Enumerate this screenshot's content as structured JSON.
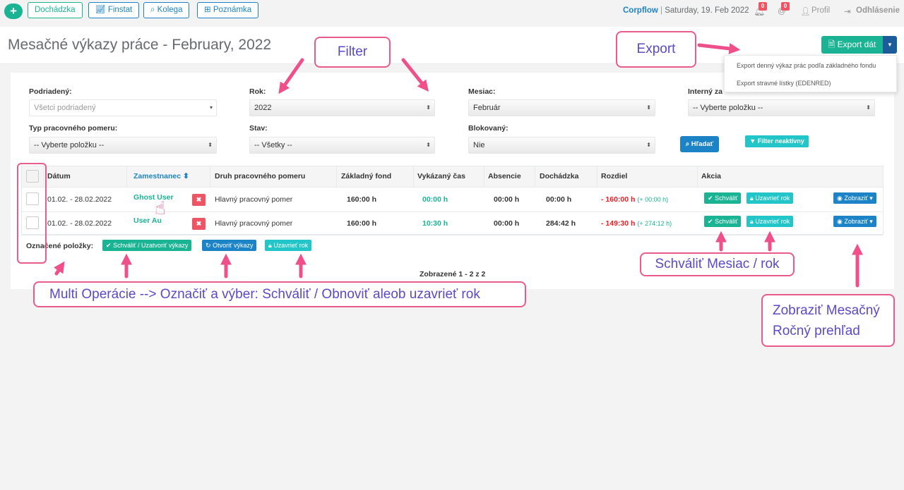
{
  "topbar": {
    "buttons": [
      {
        "label": "Dochádzka",
        "icon": "clock-icon"
      },
      {
        "label": "Finstat",
        "icon": "chart-icon"
      },
      {
        "label": "Kolega",
        "icon": "search-icon"
      },
      {
        "label": "Poznámka",
        "icon": "plus-square-icon"
      }
    ],
    "brand": "Corpflow",
    "date": "Saturday, 19. Feb 2022",
    "bell_count": "0",
    "at_count": "0",
    "profile_label": "Profil",
    "logout_label": "Odhlásenie"
  },
  "page": {
    "title": "Mesačné výkazy práce - February, 2022",
    "export_label": "Export dát",
    "export_menu": [
      "Export denný výkaz prác podľa základného fondu",
      "Export stravné lístky (EDENRED)"
    ]
  },
  "filters": {
    "podriadeny": {
      "label": "Podriadený:",
      "placeholder": "Všetci podriadený"
    },
    "rok": {
      "label": "Rok:",
      "value": "2022"
    },
    "mesiac": {
      "label": "Mesiac:",
      "value": "Február"
    },
    "interny": {
      "label": "Interný za",
      "value": "-- Vyberte položku --"
    },
    "typ": {
      "label": "Typ pracovného pomeru:",
      "value": "-- Vyberte položku --"
    },
    "stav": {
      "label": "Stav:",
      "value": "-- Všetky --"
    },
    "blokovany": {
      "label": "Blokovaný:",
      "value": "Nie"
    },
    "search_label": "Hľadať",
    "filter_inactive_label": "Filter neaktívny"
  },
  "table": {
    "headers": {
      "datum": "Dátum",
      "zamestnanec": "Zamestnanec ⬍",
      "druh": "Druh pracovného pomeru",
      "fond": "Základný fond",
      "vykazany": "Vykázaný čas",
      "absencie": "Absencie",
      "dochadzka": "Dochádzka",
      "rozdiel": "Rozdiel",
      "akcia": "Akcia"
    },
    "rows": [
      {
        "datum": "01.02. - 28.02.2022",
        "zamestnanec": "Ghost User",
        "druh": "Hlavný pracovný pomer",
        "fond": "160:00 h",
        "vykazany": "00:00 h",
        "absencie": "00:00 h",
        "dochadzka": "00:00 h",
        "rozdiel": "- 160:00 h",
        "rozdiel_extra": "(+ 00:00 h)",
        "approve": "Schváliť",
        "close_year": "Uzavrieť rok",
        "show": "Zobraziť"
      },
      {
        "datum": "01.02. - 28.02.2022",
        "zamestnanec": "User Au",
        "druh": "Hlavný pracovný pomer",
        "fond": "160:00 h",
        "vykazany": "10:30 h",
        "absencie": "00:00 h",
        "dochadzka": "284:42 h",
        "rozdiel": "- 149:30 h",
        "rozdiel_extra": "(+ 274:12 h)",
        "approve": "Schváliť",
        "close_year": "Uzavrieť rok",
        "show": "Zobraziť"
      }
    ],
    "bulk": {
      "label": "Označené položky:",
      "approve_close": "Schváliť / Uzatvoriť výkazy",
      "open": "Otvoriť výkazy",
      "close_year": "Uzavrieť rok"
    },
    "pagination": "Zobrazené 1 - 2 z 2"
  },
  "annotations": {
    "filter": "Filter",
    "export": "Export",
    "approve": "Schváliť Mesiac / rok",
    "multi": "Multi Operácie --> Označiť a výber: Schváliť / Obnoviť aleob uzavrieť rok",
    "show_line1": "Zobraziť Mesačný",
    "show_line2": "Ročný prehľad"
  },
  "colors": {
    "green": "#1ab394",
    "blue": "#1c84c6",
    "teal": "#23c6c8",
    "red": "#ed5565",
    "annotation_pink": "#e95b8a",
    "annotation_text": "#5b49c8"
  }
}
